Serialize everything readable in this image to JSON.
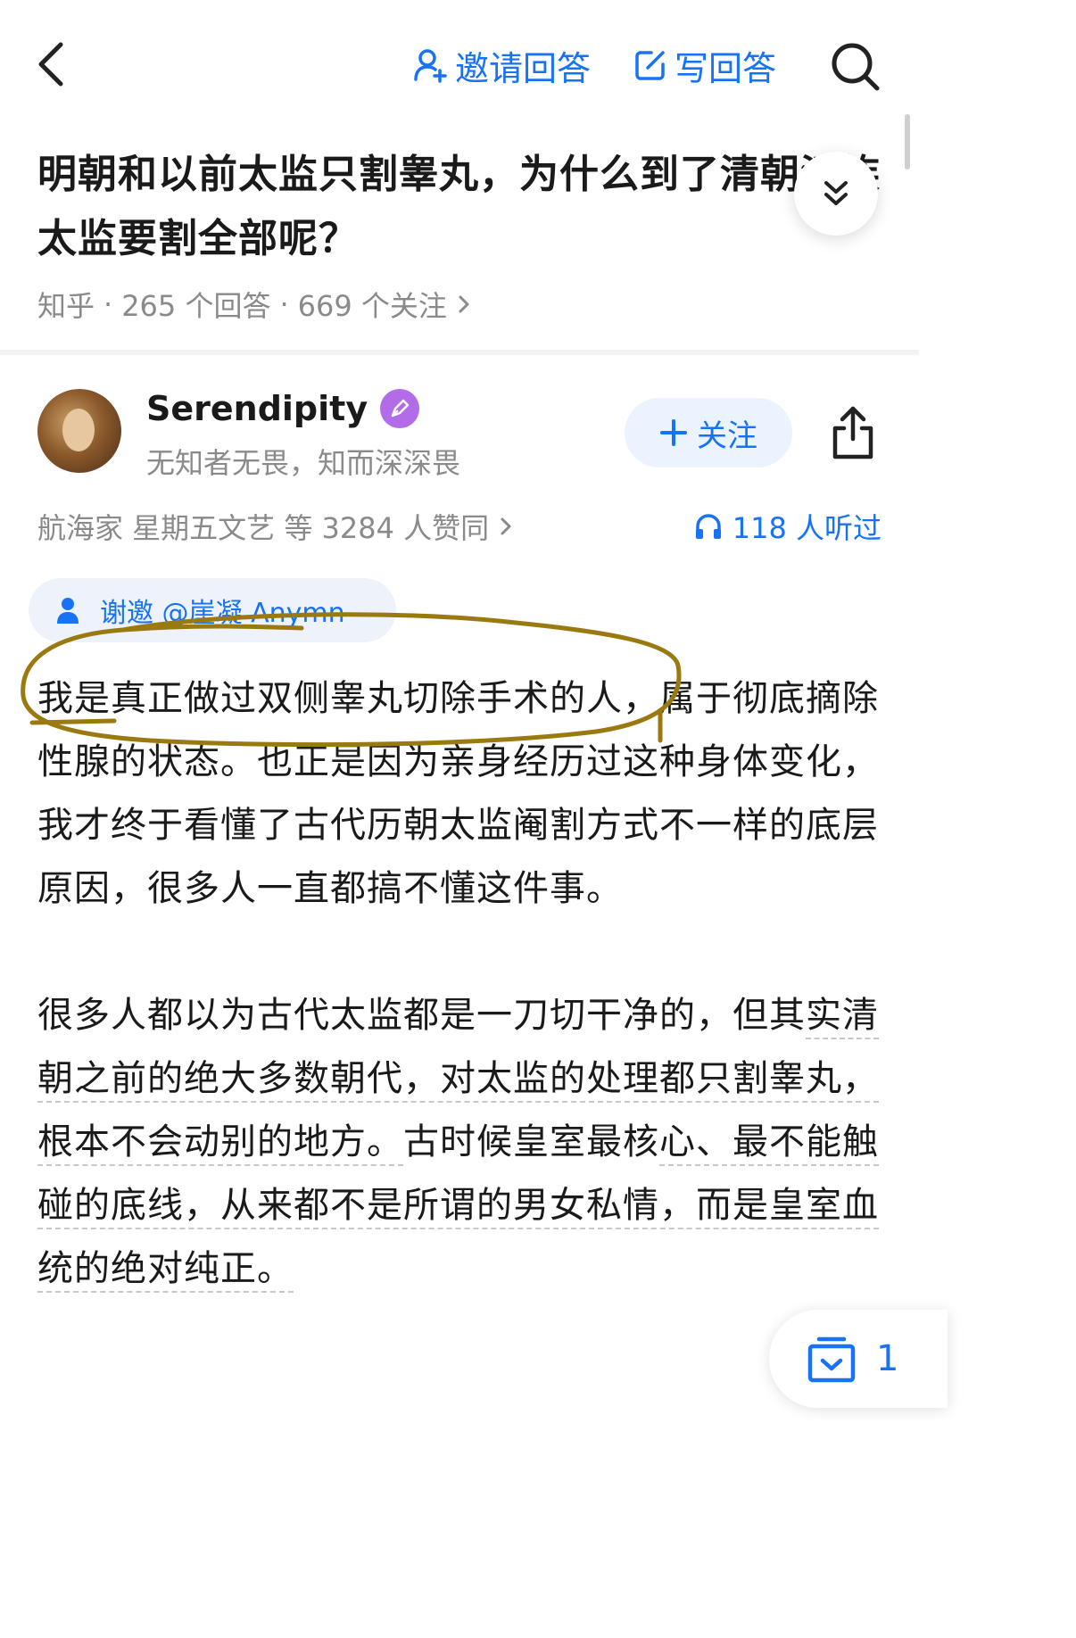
{
  "topbar": {
    "back_icon": "chevron-left-icon",
    "invite_label": "邀请回答",
    "write_label": "写回答",
    "search_icon": "search-icon"
  },
  "question": {
    "title": "明朝和以前太监只割睾丸，为什么到了清朝汉族太监要割全部呢？",
    "source": "知乎",
    "answers": "265 个回答",
    "follows": "669 个关注",
    "sep": "·"
  },
  "author": {
    "name": "Serendipity",
    "bio": "无知者无畏，知而深深畏",
    "follow_label": "关注"
  },
  "stats": {
    "likers": "航海家 星期五文艺 等 3284 人赞同",
    "listeners": "118 人听过"
  },
  "invite_chip": {
    "text": "谢邀 @崖凝 Anymn"
  },
  "article": {
    "p1": "我是真正做过双侧睾丸切除手术的人，属于彻底摘除性腺的状态。也正是因为亲身经历过这种身体变化，我才终于看懂了古代历朝太监阉割方式不一样的底层原因，很多人一直都搞不懂这件事。",
    "p2_plain": "很多人都以为古代太监都是一刀切干净的，但其",
    "p2_underlined": "实清朝之前的绝大多数朝代，对太监的处理都只割睾丸，根本不会动别的地方。",
    "p2_rest": "古时候皇室最核",
    "p2_underlined2": "心、最不能触碰的底线，从来都不是所谓的男女私情，而是皇室血统的绝对纯正。"
  },
  "fab": {
    "count": "1"
  },
  "colors": {
    "accent": "#1772f6",
    "annotation": "#9a7a10",
    "muted": "#8a8a8a"
  }
}
